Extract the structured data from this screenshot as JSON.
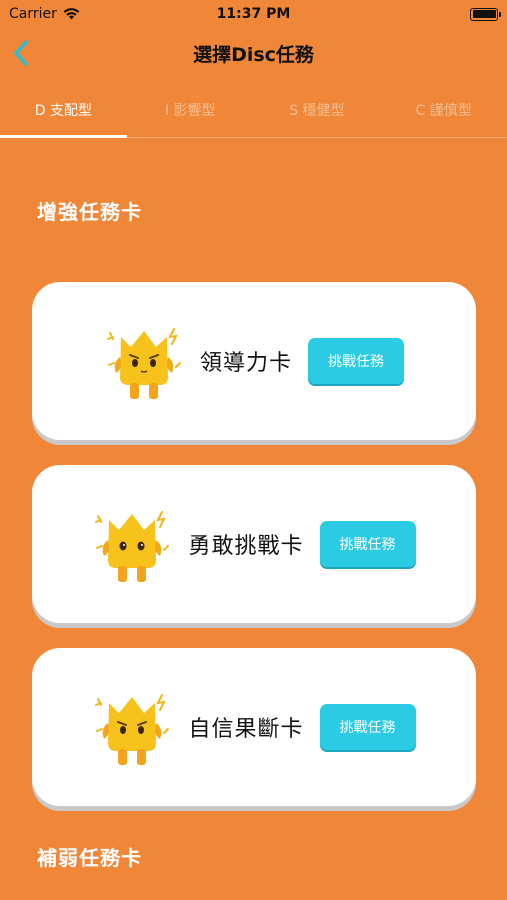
{
  "status_bar": {
    "carrier": "Carrier",
    "time": "11:37 PM"
  },
  "nav": {
    "title": "選擇Disc任務"
  },
  "tabs": [
    {
      "label": "D 支配型",
      "active": true
    },
    {
      "label": "I 影響型",
      "active": false
    },
    {
      "label": "S 穩健型",
      "active": false
    },
    {
      "label": "C 謹慎型",
      "active": false
    }
  ],
  "sections": {
    "boost_title": "增強任務卡",
    "weak_title": "補弱任務卡"
  },
  "cards": [
    {
      "label": "領導力卡",
      "button": "挑戰任務"
    },
    {
      "label": "勇敢挑戰卡",
      "button": "挑戰任務"
    },
    {
      "label": "自信果斷卡",
      "button": "挑戰任務"
    }
  ],
  "colors": {
    "background": "#ef8638",
    "accent": "#2bcbe5",
    "mascot": "#f7c21b"
  }
}
